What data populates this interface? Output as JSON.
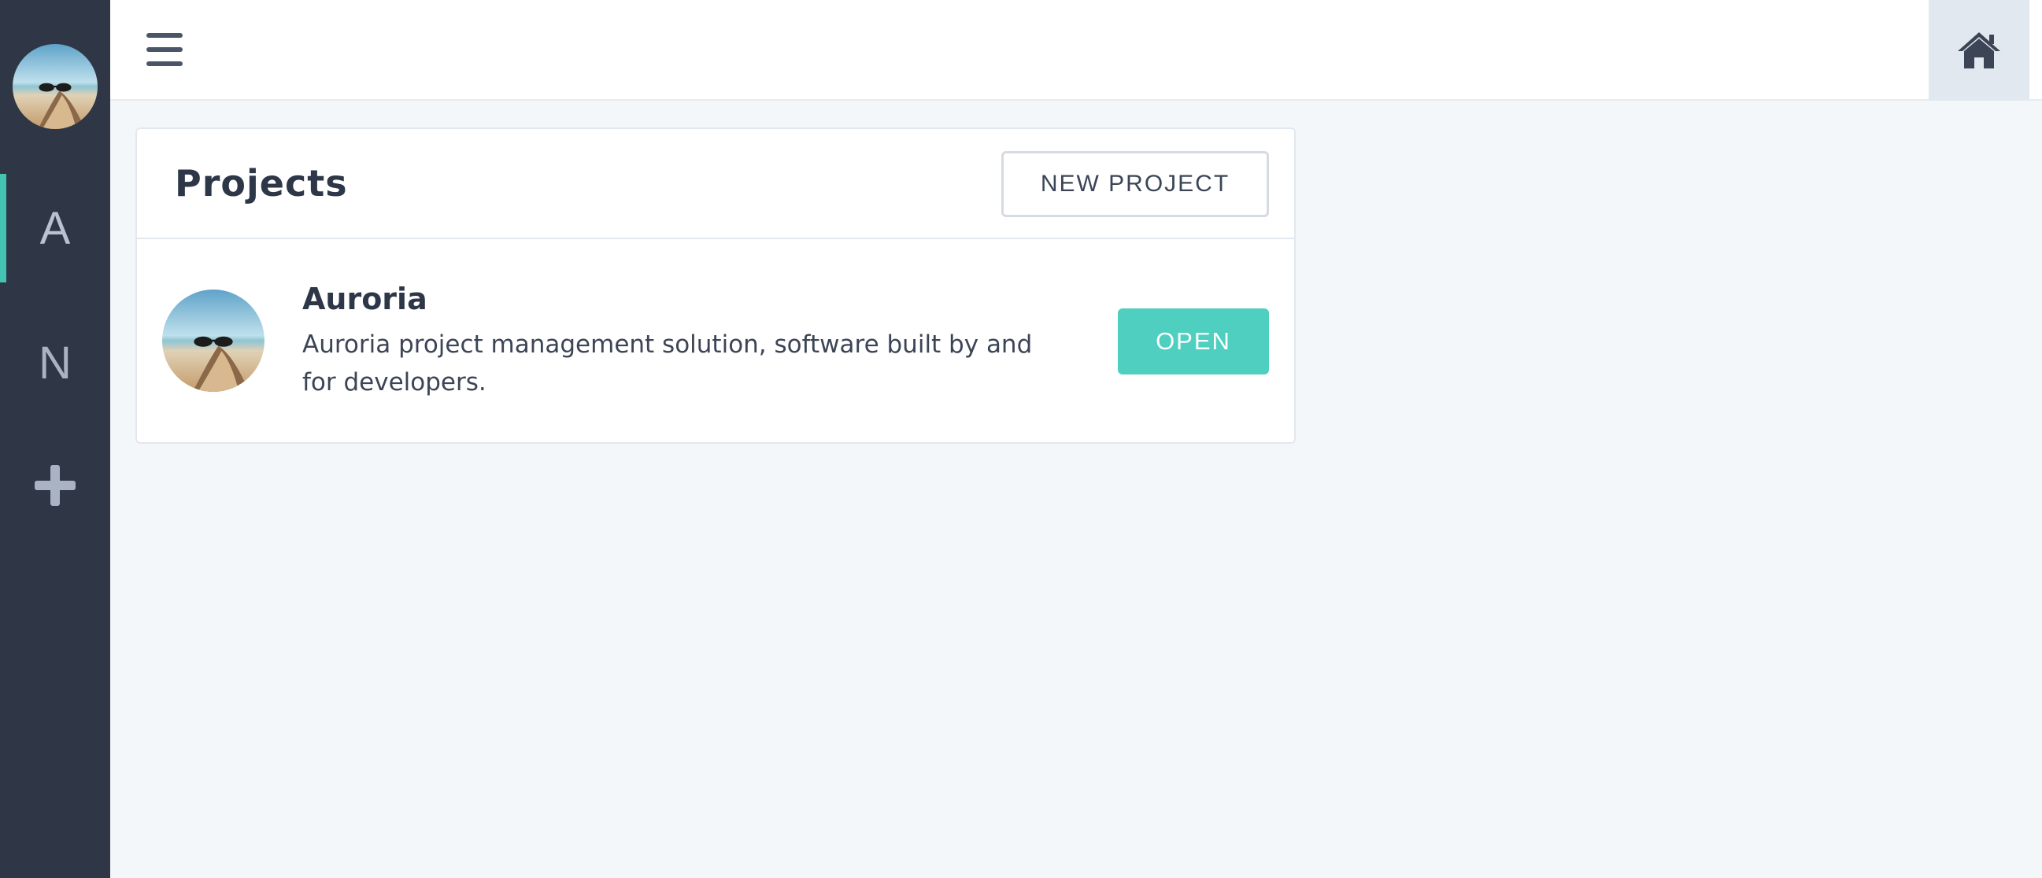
{
  "sidebar": {
    "avatar_icon": "user-avatar-beach",
    "items": [
      {
        "label": "A",
        "active": true
      },
      {
        "label": "N",
        "active": false
      }
    ],
    "add_icon": "plus-icon"
  },
  "topbar": {
    "menu_icon": "hamburger-icon",
    "home_icon": "home-icon"
  },
  "projects_card": {
    "title": "Projects",
    "new_project_label": "NEW PROJECT",
    "projects": [
      {
        "name": "Auroria",
        "description": "Auroria project management solution, software built by and for developers.",
        "open_label": "OPEN"
      }
    ]
  },
  "colors": {
    "sidebar_bg": "#2f3747",
    "accent": "#45c3b2",
    "open_button": "#4fcfbf",
    "page_bg": "#f4f7fa"
  }
}
